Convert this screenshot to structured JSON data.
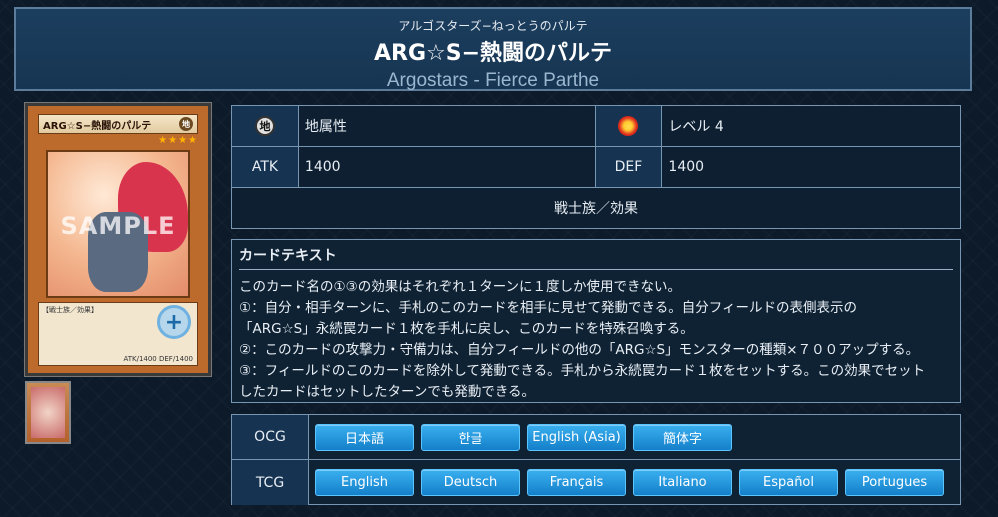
{
  "header": {
    "ruby": "アルゴスターズ−ねっとうのパルテ",
    "name_jp": "ARG☆S−熱闘のパルテ",
    "name_en": "Argostars - Fierce Parthe"
  },
  "card_image": {
    "name": "ARG☆S−熱闘のパルテ",
    "attribute_glyph": "地",
    "stars": "★★★★",
    "watermark": "SAMPLE",
    "type_line": "【戦士族／効果】",
    "stats": "ATK/1400  DEF/1400"
  },
  "info": {
    "attribute": "地属性",
    "attribute_icon": "earth-attribute-icon",
    "attribute_icon_glyph": "地",
    "level": "レベル 4",
    "level_icon": "level-star-icon",
    "level_icon_glyph": "★",
    "atk_label": "ATK",
    "atk_value": "1400",
    "def_label": "DEF",
    "def_value": "1400",
    "type": "戦士族／効果"
  },
  "card_text": {
    "heading": "カードテキスト",
    "lines": [
      "このカード名の①③の効果はそれぞれ１ターンに１度しか使用できない。",
      "①：自分・相手ターンに、手札のこのカードを相手に見せて発動できる。自分フィールドの表側表示の",
      "「ARG☆S」永続罠カード１枚を手札に戻し、このカードを特殊召喚する。",
      "②：このカードの攻撃力・守備力は、自分フィールドの他の「ARG☆S」モンスターの種類×７００アップする。",
      "③：フィールドのこのカードを除外して発動できる。手札から永続罠カード１枚をセットする。この効果でセット",
      "したカードはセットしたターンでも発動できる。"
    ]
  },
  "languages": {
    "ocg_label": "OCG",
    "ocg": [
      "日本語",
      "한글",
      "English (Asia)",
      "簡体字"
    ],
    "tcg_label": "TCG",
    "tcg": [
      "English",
      "Deutsch",
      "Français",
      "Italiano",
      "Español",
      "Portugues"
    ]
  },
  "colors": {
    "background": "#0c1a2a",
    "header": "#1c3e5e",
    "button": "#1e90d8",
    "card_frame": "#bd6a2d"
  }
}
